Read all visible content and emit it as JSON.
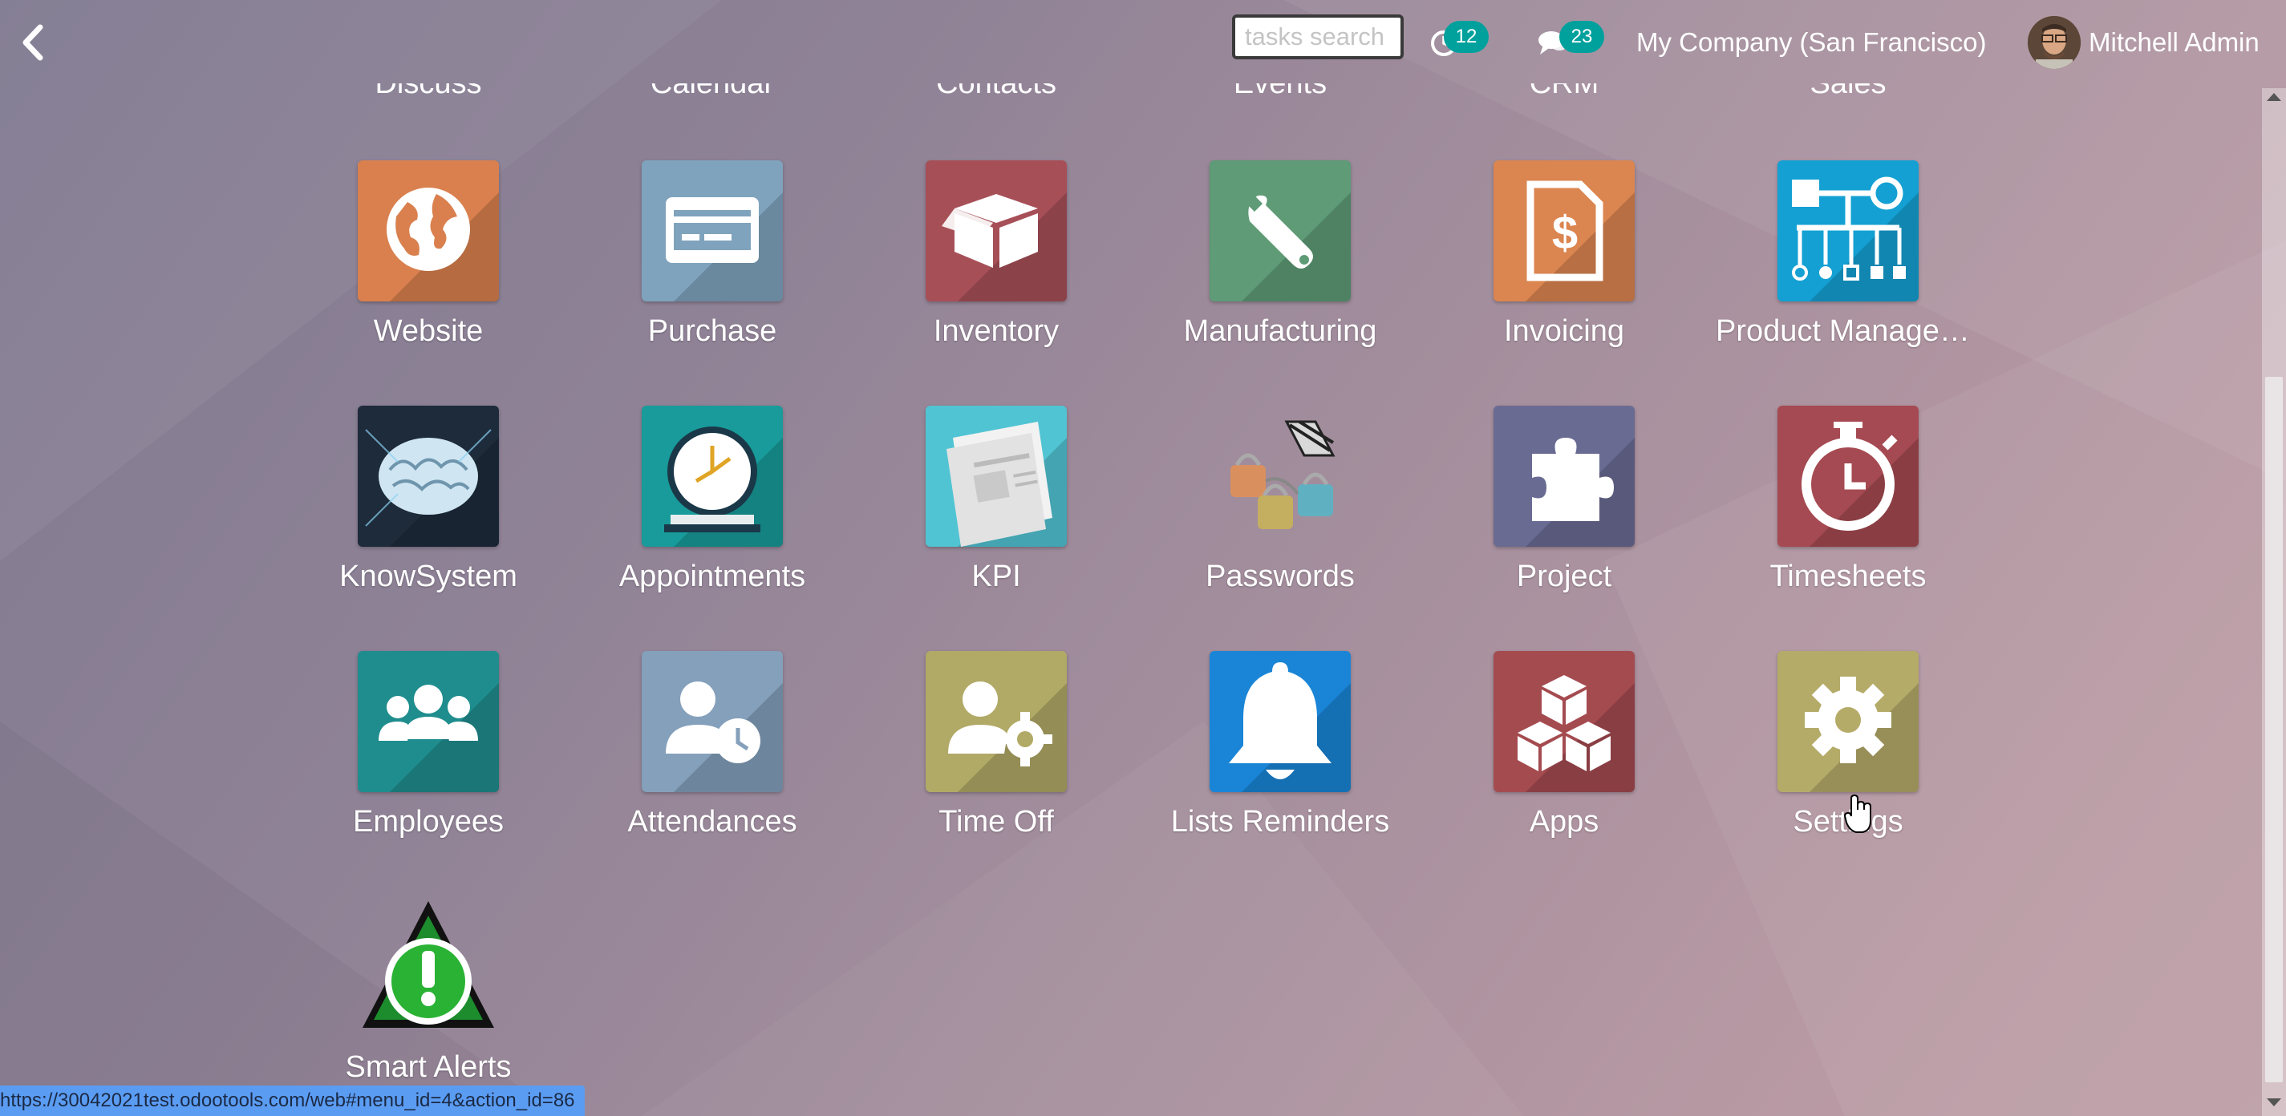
{
  "topbar": {
    "search_placeholder": "tasks search",
    "activity_count": "12",
    "messages_count": "23",
    "company": "My Company (San Francisco)",
    "user": "Mitchell Admin"
  },
  "partial_row": [
    "Discuss",
    "Calendar",
    "Contacts",
    "Events",
    "CRM",
    "Sales"
  ],
  "apps": [
    {
      "label": "Website",
      "icon": "globe-icon",
      "color": "#d9804e"
    },
    {
      "label": "Purchase",
      "icon": "credit-card-icon",
      "color": "#7fa3bd"
    },
    {
      "label": "Inventory",
      "icon": "box-icon",
      "color": "#a74f57"
    },
    {
      "label": "Manufacturing",
      "icon": "wrench-icon",
      "color": "#5e9b76"
    },
    {
      "label": "Invoicing",
      "icon": "invoice-icon",
      "color": "#db8550"
    },
    {
      "label": "Product Managem...",
      "icon": "product-tree-icon",
      "color": "#14a0d3"
    },
    {
      "label": "KnowSystem",
      "icon": "brain-icon",
      "color": "#1d2b3b"
    },
    {
      "label": "Appointments",
      "icon": "clock-icon",
      "color": "#189b9a"
    },
    {
      "label": "KPI",
      "icon": "newspaper-icon",
      "color": "#51c4d3"
    },
    {
      "label": "Passwords",
      "icon": "padlocks-icon",
      "color": "transparent"
    },
    {
      "label": "Project",
      "icon": "puzzle-icon",
      "color": "#6a6b93"
    },
    {
      "label": "Timesheets",
      "icon": "stopwatch-icon",
      "color": "#a54a52"
    },
    {
      "label": "Employees",
      "icon": "users-icon",
      "color": "#1f8d8e"
    },
    {
      "label": "Attendances",
      "icon": "user-clock-icon",
      "color": "#84a0bb"
    },
    {
      "label": "Time Off",
      "icon": "user-gear-icon",
      "color": "#b1a966"
    },
    {
      "label": "Lists Reminders",
      "icon": "bell-icon",
      "color": "#1a85d6"
    },
    {
      "label": "Apps",
      "icon": "cubes-icon",
      "color": "#a44b50"
    },
    {
      "label": "Settings",
      "icon": "gear-icon",
      "color": "#b5ab69"
    },
    {
      "label": "Smart Alerts",
      "icon": "alert-icon",
      "color": "transparent"
    }
  ],
  "status_url": "https://30042021test.odootools.com/web#menu_id=4&action_id=86"
}
